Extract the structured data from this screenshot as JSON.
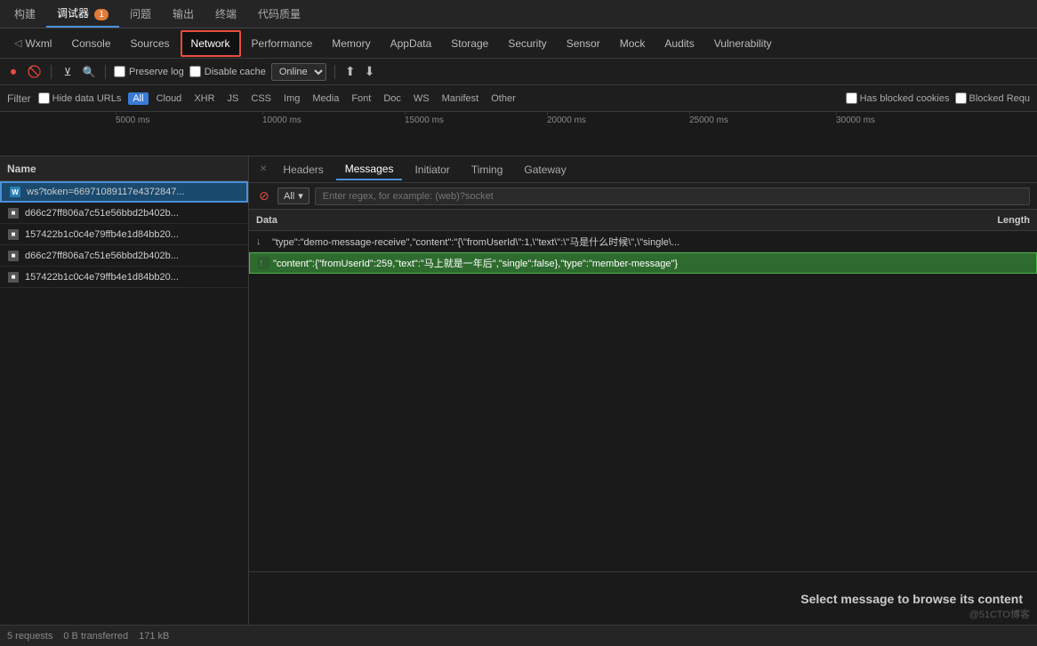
{
  "topTabs": {
    "tabs": [
      {
        "id": "build",
        "label": "构建",
        "active": false
      },
      {
        "id": "debugger",
        "label": "调试器",
        "active": true,
        "badge": "1"
      },
      {
        "id": "issues",
        "label": "问题",
        "active": false
      },
      {
        "id": "output",
        "label": "输出",
        "active": false
      },
      {
        "id": "terminal",
        "label": "终端",
        "active": false
      },
      {
        "id": "codequality",
        "label": "代码质量",
        "active": false
      }
    ]
  },
  "menuTabs": {
    "tabs": [
      {
        "id": "wxml",
        "label": "Wxml"
      },
      {
        "id": "console",
        "label": "Console"
      },
      {
        "id": "sources",
        "label": "Sources"
      },
      {
        "id": "network",
        "label": "Network",
        "active": true
      },
      {
        "id": "performance",
        "label": "Performance"
      },
      {
        "id": "memory",
        "label": "Memory"
      },
      {
        "id": "appdata",
        "label": "AppData"
      },
      {
        "id": "storage",
        "label": "Storage"
      },
      {
        "id": "security",
        "label": "Security"
      },
      {
        "id": "sensor",
        "label": "Sensor"
      },
      {
        "id": "mock",
        "label": "Mock"
      },
      {
        "id": "audits",
        "label": "Audits"
      },
      {
        "id": "vulnerability",
        "label": "Vulnerability"
      }
    ]
  },
  "toolbar": {
    "preserveLog": "Preserve log",
    "disableCache": "Disable cache",
    "onlineLabel": "Online"
  },
  "filter": {
    "label": "Filter",
    "hideDataUrls": "Hide data URLs",
    "allLabel": "All",
    "types": [
      "Cloud",
      "XHR",
      "JS",
      "CSS",
      "Img",
      "Media",
      "Font",
      "Doc",
      "WS",
      "Manifest",
      "Other"
    ],
    "hasBlockedCookies": "Has blocked cookies",
    "blockedRequ": "Blocked Requ"
  },
  "timeline": {
    "marks": [
      "5000 ms",
      "10000 ms",
      "15000 ms",
      "20000 ms",
      "25000 ms",
      "30000 ms"
    ]
  },
  "requestList": {
    "header": "Name",
    "items": [
      {
        "id": "ws1",
        "type": "ws",
        "name": "ws?token=66971089117e4372847...",
        "selected": true
      },
      {
        "id": "req1",
        "type": "req",
        "name": "d66c27ff806a7c51e56bbd2b402b..."
      },
      {
        "id": "req2",
        "type": "req",
        "name": "157422b1c0c4e79ffb4e1d84bb20..."
      },
      {
        "id": "req3",
        "type": "req",
        "name": "d66c27ff806a7c51e56bbd2b402b..."
      },
      {
        "id": "req4",
        "type": "req",
        "name": "157422b1c0c4e79ffb4e1d84bb20..."
      }
    ]
  },
  "subTabs": {
    "tabs": [
      {
        "id": "headers",
        "label": "Headers"
      },
      {
        "id": "messages",
        "label": "Messages",
        "active": true
      },
      {
        "id": "initiator",
        "label": "Initiator"
      },
      {
        "id": "timing",
        "label": "Timing"
      },
      {
        "id": "gateway",
        "label": "Gateway"
      }
    ]
  },
  "msgFilter": {
    "allLabel": "All",
    "placeholder": "Enter regex, for example: (web)?socket"
  },
  "msgTable": {
    "colData": "Data",
    "colLength": "Length",
    "rows": [
      {
        "id": "msg1",
        "direction": "down",
        "data": "\"type\":\"demo-message-receive\",\"content\":\"{\\\"fromUserId\\\":1,\\\"text\\\":\\\"马是什么时候\\\",\\\"single\\...",
        "selected": false
      },
      {
        "id": "msg2",
        "direction": "up",
        "data": "\"content\":{\"fromUserId\":259,\"text\":\"马上就是一年后\",\"single\":false},\"type\":\"member-message\"}",
        "selected": true
      }
    ]
  },
  "selectMessage": {
    "text": "Select message to browse its content"
  },
  "statusBar": {
    "requests": "5 requests",
    "transferred": "0 B transferred",
    "size": "171 kB"
  },
  "watermark": "@51CTO博客"
}
